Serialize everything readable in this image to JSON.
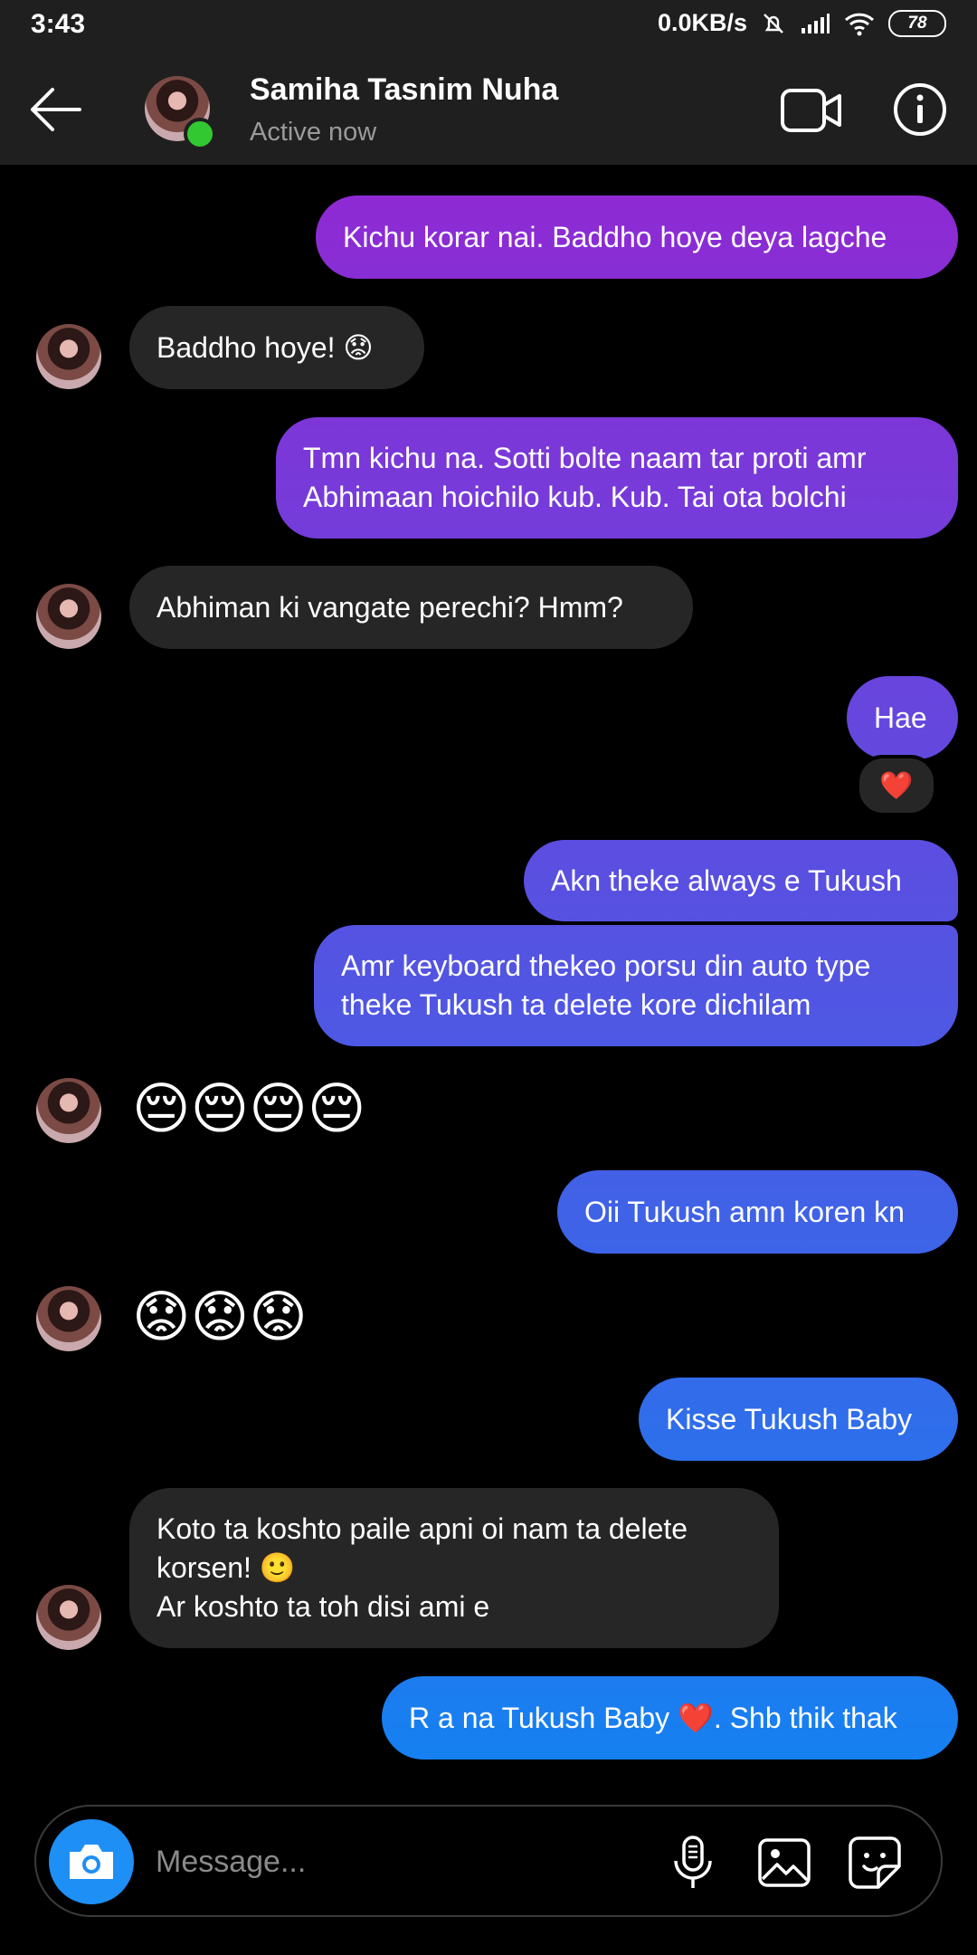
{
  "status_bar": {
    "time": "3:43",
    "network_speed": "0.0KB/s",
    "battery": "78"
  },
  "header": {
    "contact_name": "Samiha Tasnim Nuha",
    "status": "Active now",
    "online_color": "#32c832"
  },
  "messages": [
    {
      "dir": "sent",
      "lines": [
        "Kichu korar nai. Baddho hoye deya lagche"
      ]
    },
    {
      "dir": "received",
      "lines": [
        "Baddho hoye! 😟"
      ]
    },
    {
      "dir": "sent",
      "lines": [
        "Tmn kichu na. Sotti bolte naam tar proti amr",
        "Abhimaan hoichilo kub. Kub. Tai ota bolchi"
      ]
    },
    {
      "dir": "received",
      "lines": [
        "Abhiman ki vangate perechi? Hmm?"
      ]
    },
    {
      "dir": "sent",
      "lines": [
        "Hae"
      ],
      "reaction": "❤️"
    },
    {
      "dir": "sent",
      "lines": [
        "Akn theke always e Tukush"
      ]
    },
    {
      "dir": "sent",
      "lines": [
        "Amr keyboard thekeo porsu din auto type",
        "theke Tukush ta delete kore dichilam"
      ]
    },
    {
      "dir": "received",
      "emoji": "😔😔😔😔"
    },
    {
      "dir": "sent",
      "lines": [
        "Oii Tukush amn koren kn"
      ]
    },
    {
      "dir": "received",
      "emoji": "😟😟😟"
    },
    {
      "dir": "sent",
      "lines": [
        "Kisse Tukush Baby"
      ]
    },
    {
      "dir": "received",
      "lines": [
        "Koto ta koshto paile apni oi nam ta delete",
        "korsen! 🙂",
        "Ar koshto ta toh disi ami e"
      ]
    },
    {
      "dir": "sent",
      "lines": [
        "R a na Tukush Baby ❤️. Shb thik thak"
      ]
    }
  ],
  "composer": {
    "placeholder": "Message..."
  },
  "colors": {
    "background": "#000000",
    "received_bubble": "#262626",
    "sent_gradient_top": "#9d1fd0",
    "sent_gradient_bottom": "#1283f2",
    "camera_button": "#1e8ff5"
  }
}
